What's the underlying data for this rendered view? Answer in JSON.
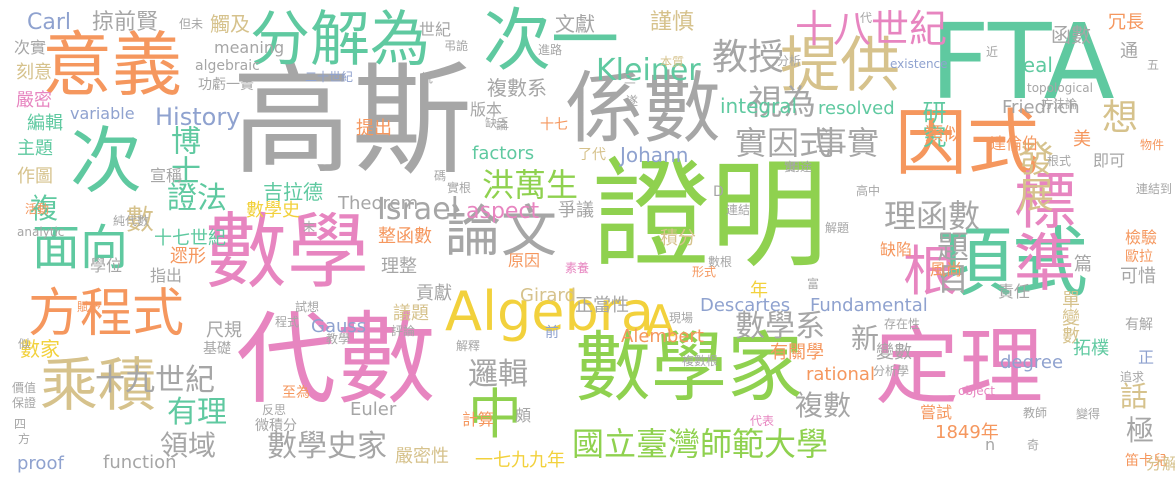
{
  "palette": {
    "green": "#8fd14f",
    "teal": "#5fc9a0",
    "gray": "#a6a6a6",
    "orange": "#f5975e",
    "pink": "#e785c0",
    "tan": "#d6c28c",
    "blue": "#8fa2cf",
    "yellow": "#f2d13c"
  },
  "words": [
    {
      "text": "高斯"
    },
    {
      "text": "證明"
    },
    {
      "text": "數學"
    },
    {
      "text": "代數"
    },
    {
      "text": "FTA"
    },
    {
      "text": "係數"
    },
    {
      "text": "分解為"
    },
    {
      "text": "次一"
    },
    {
      "text": "意義"
    },
    {
      "text": "次"
    },
    {
      "text": "因式"
    },
    {
      "text": "定理"
    },
    {
      "text": "數學家"
    },
    {
      "text": "項式"
    },
    {
      "text": "提供"
    },
    {
      "text": "標準"
    },
    {
      "text": "乘積"
    },
    {
      "text": "方程式"
    },
    {
      "text": "面向"
    },
    {
      "text": "論文"
    },
    {
      "text": "根"
    },
    {
      "text": "中"
    },
    {
      "text": "Algebra"
    },
    {
      "text": "A"
    },
    {
      "text": "十八世紀"
    },
    {
      "text": "教授"
    },
    {
      "text": "視為"
    },
    {
      "text": "Kleiner"
    },
    {
      "text": "實因式"
    },
    {
      "text": "事實"
    },
    {
      "text": "理函數"
    },
    {
      "text": "題目"
    },
    {
      "text": "數學系"
    },
    {
      "text": "國立臺灣師範大學"
    },
    {
      "text": "數學史家"
    },
    {
      "text": "十九世紀"
    },
    {
      "text": "洪萬生"
    },
    {
      "text": "邏輯"
    },
    {
      "text": "博士"
    },
    {
      "text": "證法"
    },
    {
      "text": "Israel"
    },
    {
      "text": "aspect"
    },
    {
      "text": "History"
    },
    {
      "text": "有理"
    },
    {
      "text": "領域"
    },
    {
      "text": "複數"
    },
    {
      "text": "發展"
    },
    {
      "text": "研究"
    },
    {
      "text": "想"
    },
    {
      "text": "數"
    },
    {
      "text": "複"
    },
    {
      "text": "新"
    },
    {
      "text": "話"
    },
    {
      "text": "極"
    },
    {
      "text": "Carl"
    },
    {
      "text": "掠前賢"
    },
    {
      "text": "觸及"
    },
    {
      "text": "世紀"
    },
    {
      "text": "文獻"
    },
    {
      "text": "謹慎"
    },
    {
      "text": "冗長"
    },
    {
      "text": "函數"
    },
    {
      "text": "通"
    },
    {
      "text": "real"
    },
    {
      "text": "次實"
    },
    {
      "text": "刻意"
    },
    {
      "text": "嚴密"
    },
    {
      "text": "編輯"
    },
    {
      "text": "主題"
    },
    {
      "text": "作圖"
    },
    {
      "text": "variable"
    },
    {
      "text": "integral"
    },
    {
      "text": "resolved"
    },
    {
      "text": "factors"
    },
    {
      "text": "Friedrich"
    },
    {
      "text": "Johann"
    },
    {
      "text": "複數系"
    },
    {
      "text": "版本"
    },
    {
      "text": "十七"
    },
    {
      "text": "了代"
    },
    {
      "text": "吉拉德"
    },
    {
      "text": "數學史"
    },
    {
      "text": "Theorem"
    },
    {
      "text": "爭議"
    },
    {
      "text": "宣稱"
    },
    {
      "text": "十七世紀"
    },
    {
      "text": "學位"
    },
    {
      "text": "遝形"
    },
    {
      "text": "指出"
    },
    {
      "text": "尺規"
    },
    {
      "text": "基礎"
    },
    {
      "text": "數家"
    },
    {
      "text": "proof"
    },
    {
      "text": "function"
    },
    {
      "text": "嚴密性"
    },
    {
      "text": "一七九九年"
    },
    {
      "text": "整函數"
    },
    {
      "text": "理整"
    },
    {
      "text": "貢獻"
    },
    {
      "text": "議題"
    },
    {
      "text": "Gauss"
    },
    {
      "text": "Girard"
    },
    {
      "text": "正當性"
    },
    {
      "text": "Descartes"
    },
    {
      "text": "Fundamental"
    },
    {
      "text": "degree"
    },
    {
      "text": "rational"
    },
    {
      "text": "有關學"
    },
    {
      "text": "變數"
    },
    {
      "text": "責任"
    },
    {
      "text": "單變數"
    },
    {
      "text": "篇"
    },
    {
      "text": "可惜"
    },
    {
      "text": "風尚"
    },
    {
      "text": "缺陷"
    },
    {
      "text": "積分"
    },
    {
      "text": "年"
    },
    {
      "text": "美"
    },
    {
      "text": "即可"
    },
    {
      "text": "類似"
    },
    {
      "text": "達倫伯"
    },
    {
      "text": "檢驗"
    },
    {
      "text": "歐拉"
    },
    {
      "text": "嘗試"
    },
    {
      "text": "1849年"
    },
    {
      "text": "笛卡兒"
    },
    {
      "text": "分解"
    },
    {
      "text": "拓樸"
    },
    {
      "text": "正"
    },
    {
      "text": "n"
    },
    {
      "text": "Euler"
    },
    {
      "text": "頗"
    },
    {
      "text": "計算"
    },
    {
      "text": "原因"
    },
    {
      "text": "提出"
    },
    {
      "text": "前"
    },
    {
      "text": "Alembert"
    },
    {
      "text": "功虧一簣"
    },
    {
      "text": "二十世紀"
    },
    {
      "text": "algebraic"
    },
    {
      "text": "meaning"
    },
    {
      "text": "但未"
    },
    {
      "text": "本質"
    },
    {
      "text": "existence"
    },
    {
      "text": "topological"
    },
    {
      "text": "方法論"
    },
    {
      "text": "進路"
    },
    {
      "text": "分析"
    },
    {
      "text": "根式"
    },
    {
      "text": "物件"
    },
    {
      "text": "連結到"
    },
    {
      "text": "高中"
    },
    {
      "text": "解題"
    },
    {
      "text": "連結"
    },
    {
      "text": "實根"
    },
    {
      "text": "素養"
    },
    {
      "text": "數根"
    },
    {
      "text": "形式"
    },
    {
      "text": "有解"
    },
    {
      "text": "存在性"
    },
    {
      "text": "現場"
    },
    {
      "text": "解釋"
    },
    {
      "text": "教學"
    },
    {
      "text": "評論"
    },
    {
      "text": "程式"
    },
    {
      "text": "試想"
    },
    {
      "text": "賦予"
    },
    {
      "text": "活動"
    },
    {
      "text": "analytic"
    },
    {
      "text": "純代數"
    },
    {
      "text": "複數根"
    },
    {
      "text": "object"
    },
    {
      "text": "至為"
    },
    {
      "text": "反思"
    },
    {
      "text": "微積分"
    },
    {
      "text": "代表"
    },
    {
      "text": "分析學"
    },
    {
      "text": "教師"
    },
    {
      "text": "追求"
    },
    {
      "text": "價值"
    },
    {
      "text": "保證"
    },
    {
      "text": "四"
    },
    {
      "text": "方"
    },
    {
      "text": "似"
    },
    {
      "text": "變得"
    },
    {
      "text": "五"
    },
    {
      "text": "三"
    },
    {
      "text": "遂"
    },
    {
      "text": "論"
    },
    {
      "text": "末"
    },
    {
      "text": "說"
    },
    {
      "text": "近"
    },
    {
      "text": "奇"
    },
    {
      "text": "缺乏"
    },
    {
      "text": "用途"
    },
    {
      "text": "富"
    },
    {
      "text": "實"
    },
    {
      "text": "代"
    },
    {
      "text": "碼"
    },
    {
      "text": "弔詭"
    },
    {
      "text": "D"
    }
  ]
}
